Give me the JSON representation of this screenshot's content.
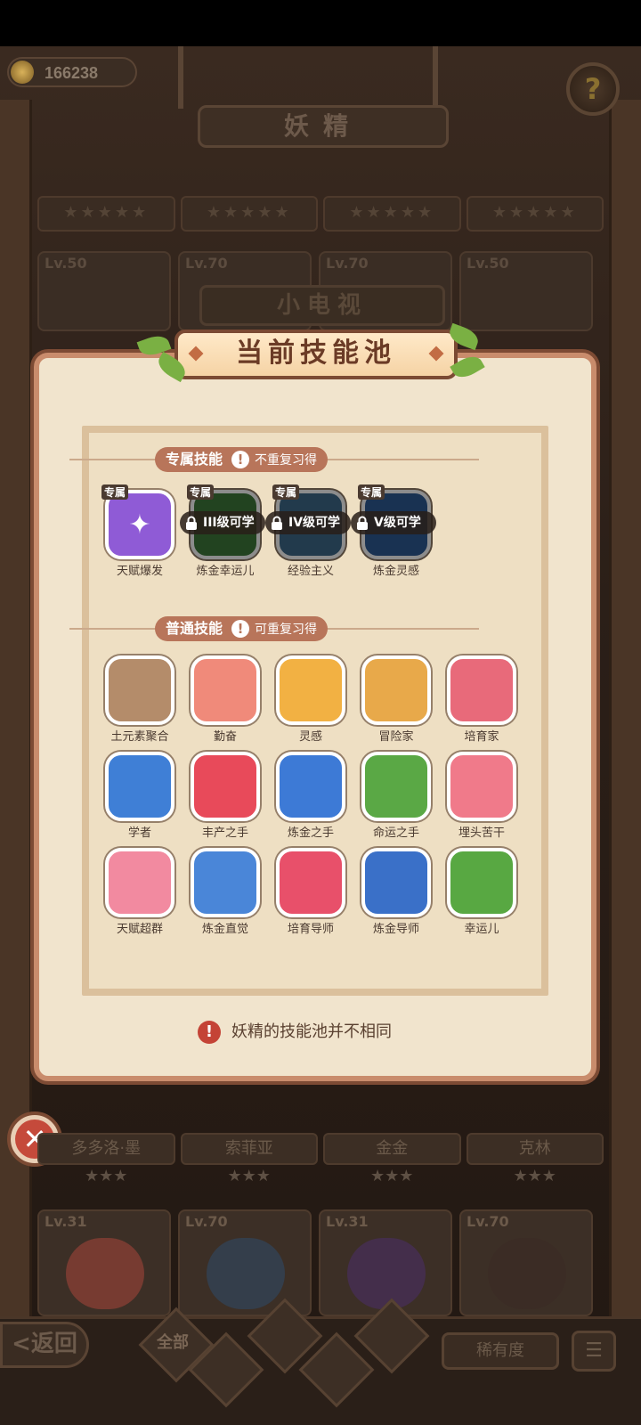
{
  "header": {
    "currency_value": "166238",
    "help_glyph": "?",
    "page_title": "妖精"
  },
  "bg_cards": {
    "stars": "★★★★★",
    "levels": [
      "Lv.50",
      "Lv.70",
      "Lv.70",
      "Lv.50"
    ],
    "tv_label": "小电视"
  },
  "panel": {
    "title": "当前技能池",
    "exclusive": {
      "label": "专属技能",
      "sub": "不重复习得",
      "tag": "专属",
      "skills": [
        {
          "name": "天赋爆发",
          "lock": "",
          "color": "#8f5bd6"
        },
        {
          "name": "炼金幸运儿",
          "lock": "III级可学",
          "color": "#3d7a3a"
        },
        {
          "name": "经验主义",
          "lock": "IV级可学",
          "color": "#3d6a8a"
        },
        {
          "name": "炼金灵感",
          "lock": "V级可学",
          "color": "#2d5a96"
        }
      ]
    },
    "common": {
      "label": "普通技能",
      "sub": "可重复习得",
      "skills": [
        {
          "name": "土元素聚合",
          "color": "#b48c6a"
        },
        {
          "name": "勤奋",
          "color": "#f08a7a"
        },
        {
          "name": "灵感",
          "color": "#f2b143"
        },
        {
          "name": "冒险家",
          "color": "#e8a94a"
        },
        {
          "name": "培育家",
          "color": "#e86a7a"
        },
        {
          "name": "学者",
          "color": "#3f7fd6"
        },
        {
          "name": "丰产之手",
          "color": "#e84a5a"
        },
        {
          "name": "炼金之手",
          "color": "#3d7ad6"
        },
        {
          "name": "命运之手",
          "color": "#5aa845"
        },
        {
          "name": "埋头苦干",
          "color": "#f07a8a"
        },
        {
          "name": "天赋超群",
          "color": "#f28aa0"
        },
        {
          "name": "炼金直觉",
          "color": "#4a86d8"
        },
        {
          "name": "培育导师",
          "color": "#e8506a"
        },
        {
          "name": "炼金导师",
          "color": "#3a70c8"
        },
        {
          "name": "幸运儿",
          "color": "#58a842"
        }
      ]
    },
    "note": "妖精的技能池并不相同"
  },
  "close_glyph": "✕",
  "roster": {
    "names": [
      "多多洛·墨",
      "索菲亚",
      "金金",
      "克林"
    ],
    "stars": [
      "★★★",
      "★★★",
      "★★★",
      "★★★"
    ],
    "levels": [
      "Lv.31",
      "Lv.70",
      "Lv.31",
      "Lv.70"
    ]
  },
  "bottom": {
    "back": "<返回",
    "filter_all": "全部",
    "rarity": "稀有度",
    "sort_glyph": "☰"
  }
}
